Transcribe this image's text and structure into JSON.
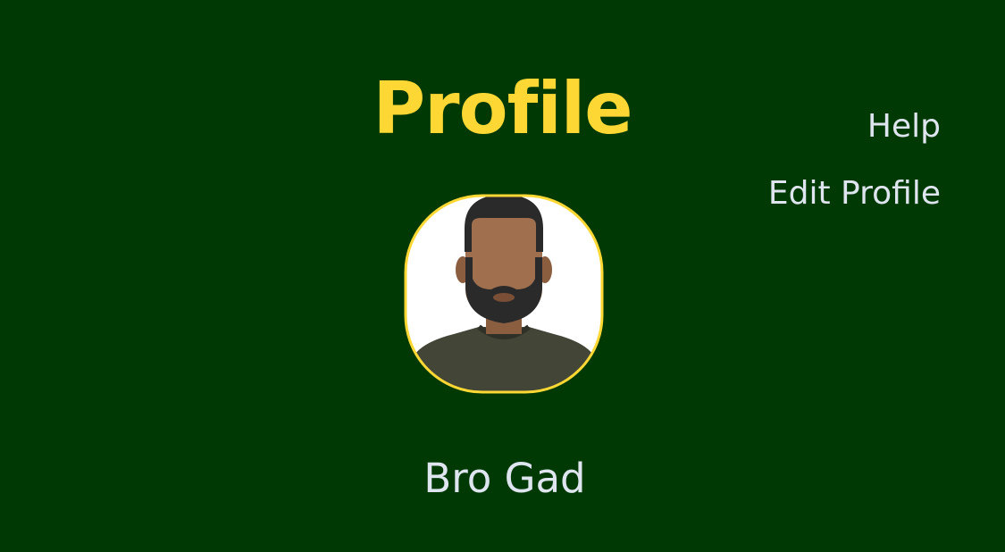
{
  "header": {
    "title": "Profile"
  },
  "menu": {
    "help_label": "Help",
    "edit_profile_label": "Edit Profile"
  },
  "profile": {
    "name": "Bro Gad",
    "avatar_icon": "person-avatar-icon"
  },
  "colors": {
    "background": "#013905",
    "accent": "#fdd835",
    "text": "#dfe5ef"
  }
}
